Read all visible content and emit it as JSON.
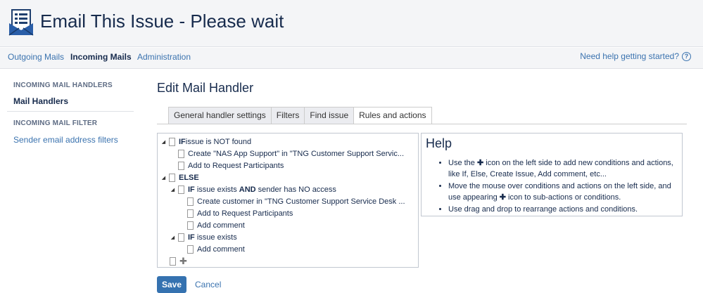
{
  "header": {
    "title": "Email This Issue - Please wait",
    "logo_icon": "envelope-checklist-icon"
  },
  "nav": {
    "items": [
      {
        "label": "Outgoing Mails"
      },
      {
        "label": "Incoming Mails"
      },
      {
        "label": "Administration"
      }
    ],
    "help_label": "Need help getting started?",
    "help_icon_glyph": "?"
  },
  "sidebar": {
    "sections": [
      {
        "heading": "INCOMING MAIL HANDLERS",
        "items": [
          {
            "label": "Mail Handlers"
          }
        ]
      },
      {
        "heading": "INCOMING MAIL FILTER",
        "items": [
          {
            "label": "Sender email address filters"
          }
        ]
      }
    ]
  },
  "main": {
    "title": "Edit Mail Handler",
    "tabs": [
      {
        "label": "General handler settings"
      },
      {
        "label": "Filters"
      },
      {
        "label": "Find issue"
      },
      {
        "label": "Rules and actions"
      }
    ],
    "tree": [
      {
        "kw": "IF",
        "text": " issue is NOT found"
      },
      {
        "text": "Create \"NAS App Support\" in \"TNG Customer Support Servic..."
      },
      {
        "text": "Add to Request Participants"
      },
      {
        "kw": "ELSE"
      },
      {
        "kw": "IF",
        "text_a": " issue exists ",
        "kw2": "AND",
        "text_b": " sender has NO access"
      },
      {
        "text": "Create customer in \"TNG Customer Support Service Desk ..."
      },
      {
        "text": "Add to Request Participants"
      },
      {
        "text": "Add comment"
      },
      {
        "kw": "IF",
        "text": " issue exists"
      },
      {
        "text": "Add comment"
      },
      {
        "plus": "✚"
      }
    ],
    "help": {
      "title": "Help",
      "bullets": [
        {
          "a": "Use the ",
          "icon": "✚",
          "b": " icon on the left side to add new conditions and actions, like If, Else, Create Issue, Add comment, etc..."
        },
        {
          "a": "Move the mouse over conditions and actions on the left side, and use appearing ",
          "icon": "✚",
          "b": " icon to sub-actions or conditions."
        },
        {
          "a": "Use drag and drop to rearrange actions and conditions."
        }
      ]
    },
    "save_label": "Save",
    "cancel_label": "Cancel"
  },
  "colors": {
    "link": "#3b73af",
    "primary_button": "#3572b0",
    "header_bg": "#f4f5f7"
  }
}
